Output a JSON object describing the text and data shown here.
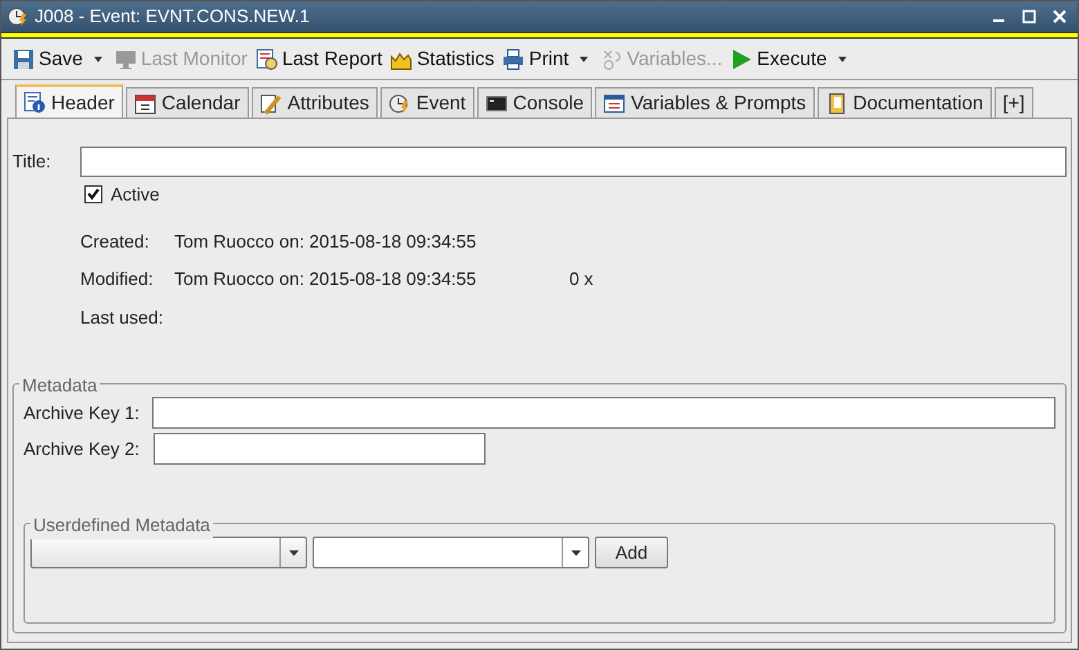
{
  "window": {
    "title": "J008 - Event: EVNT.CONS.NEW.1"
  },
  "toolbar": [
    {
      "label": "Save",
      "kind": "floppy",
      "disabled": false,
      "dropdown": true
    },
    {
      "label": "Last Monitor",
      "kind": "monitor",
      "disabled": true,
      "dropdown": false
    },
    {
      "label": "Last Report",
      "kind": "report",
      "disabled": false,
      "dropdown": false
    },
    {
      "label": "Statistics",
      "kind": "chart",
      "disabled": false,
      "dropdown": false
    },
    {
      "label": "Print",
      "kind": "printer",
      "disabled": false,
      "dropdown": true
    },
    {
      "label": "Variables...",
      "kind": "vars",
      "disabled": true,
      "dropdown": false
    },
    {
      "label": "Execute",
      "kind": "play",
      "disabled": false,
      "dropdown": true
    }
  ],
  "tabs": [
    {
      "label": "Header",
      "kind": "info",
      "selected": true
    },
    {
      "label": "Calendar",
      "kind": "calendar",
      "selected": false
    },
    {
      "label": "Attributes",
      "kind": "pencil",
      "selected": false
    },
    {
      "label": "Event",
      "kind": "clock",
      "selected": false
    },
    {
      "label": "Console",
      "kind": "console",
      "selected": false
    },
    {
      "label": "Variables & Prompts",
      "kind": "window",
      "selected": false
    },
    {
      "label": "Documentation",
      "kind": "book",
      "selected": false
    },
    {
      "label": "[+]",
      "kind": "plain",
      "selected": false
    }
  ],
  "header": {
    "title_label": "Title:",
    "active": {
      "label": "Active",
      "checked": true
    },
    "created": {
      "label": "Created:",
      "value": "Tom Ruocco on: 2015-08-18 09:34:55"
    },
    "modified": {
      "label": "Modified:",
      "value": "Tom Ruocco on: 2015-08-18 09:34:55",
      "count": "0 x"
    },
    "last_used": {
      "label": "Last used:"
    }
  },
  "metadata": {
    "title": "Metadata",
    "archive_key_1": "Archive Key 1:",
    "archive_key_2": "Archive Key 2:",
    "userdefined": {
      "title": "Userdefined Metadata",
      "add_button": "Add"
    }
  }
}
